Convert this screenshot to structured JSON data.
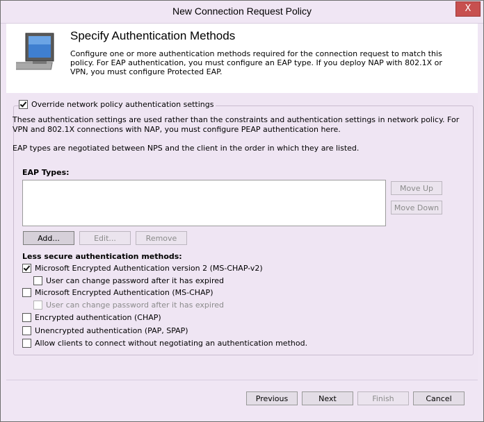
{
  "window": {
    "title": "New Connection Request Policy",
    "close_label": "X"
  },
  "header": {
    "title": "Specify Authentication Methods",
    "description": "Configure one or more authentication methods required for the connection request to match this policy. For EAP authentication, you must configure an EAP type. If you deploy NAP with 802.1X or VPN, you must configure Protected EAP."
  },
  "override": {
    "label": "Override network policy authentication settings",
    "checked": true
  },
  "info1": "These authentication settings are used rather than the constraints and authentication settings in network policy. For VPN and 802.1X connections with NAP, you must configure PEAP authentication here.",
  "info2": "EAP types are negotiated between NPS and the client in the order in which they are listed.",
  "eap": {
    "label": "EAP Types:",
    "items": [],
    "move_up": "Move Up",
    "move_down": "Move Down",
    "add": "Add...",
    "edit": "Edit...",
    "remove": "Remove"
  },
  "less_secure": {
    "label": "Less secure authentication methods:",
    "items": [
      {
        "label": "Microsoft Encrypted Authentication version 2 (MS-CHAP-v2)",
        "checked": true,
        "enabled": true
      },
      {
        "label": "User can change password after it has expired",
        "checked": false,
        "enabled": true
      },
      {
        "label": "Microsoft Encrypted Authentication (MS-CHAP)",
        "checked": false,
        "enabled": true
      },
      {
        "label": "User can change password after it has expired",
        "checked": false,
        "enabled": false
      },
      {
        "label": "Encrypted authentication (CHAP)",
        "checked": false,
        "enabled": true
      },
      {
        "label": "Unencrypted authentication (PAP, SPAP)",
        "checked": false,
        "enabled": true
      },
      {
        "label": "Allow clients to connect without negotiating an authentication method.",
        "checked": false,
        "enabled": true
      }
    ]
  },
  "footer": {
    "previous": "Previous",
    "next": "Next",
    "finish": "Finish",
    "cancel": "Cancel"
  },
  "icons": {
    "header": "computer-monitor-icon"
  }
}
